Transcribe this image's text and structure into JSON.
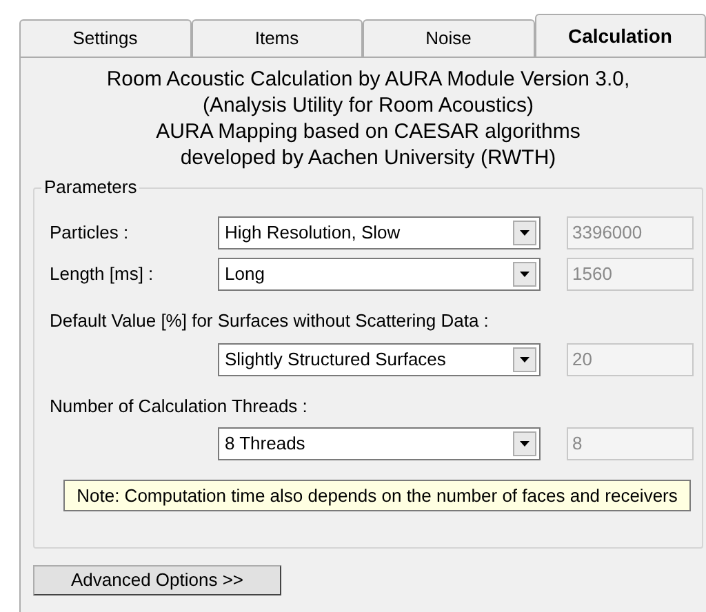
{
  "tabs": [
    {
      "label": "Settings",
      "selected": false
    },
    {
      "label": "Items",
      "selected": false
    },
    {
      "label": "Noise",
      "selected": false
    },
    {
      "label": "Calculation",
      "selected": true
    }
  ],
  "heading": [
    "Room Acoustic Calculation by AURA Module Version 3.0,",
    "(Analysis Utility for Room Acoustics)",
    "AURA Mapping based on CAESAR algorithms",
    "developed by Aachen University (RWTH)"
  ],
  "parameters": {
    "title": "Parameters",
    "rows": [
      {
        "kind": "inline",
        "label": "Particles :",
        "selection": "High Resolution, Slow",
        "value": "3396000"
      },
      {
        "kind": "inline",
        "label": "Length [ms] :",
        "selection": "Long",
        "value": "1560"
      },
      {
        "kind": "stacked",
        "label": "Default Value [%] for Surfaces without Scattering Data :",
        "selection": "Slightly Structured Surfaces",
        "value": "20"
      },
      {
        "kind": "stacked",
        "label": "Number of Calculation Threads :",
        "selection": "8 Threads",
        "value": "8"
      }
    ],
    "note": "Note: Computation time also depends on the number of faces and receivers"
  },
  "button": "Advanced Options >>"
}
